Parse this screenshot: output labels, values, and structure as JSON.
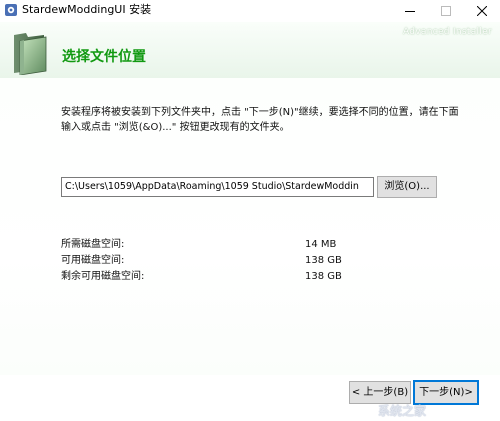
{
  "window": {
    "title": "StardewModdingUI 安装",
    "controls": [
      "minimize",
      "maximize",
      "close"
    ]
  },
  "header": {
    "title": "选择文件位置",
    "brand": "Advanced Installer",
    "icon": "green-folder-icon"
  },
  "description": "安装程序将被安装到下列文件夹中，点击 \"下一步(N)\"继续，要选择不同的位置，请在下面输入或点击 \"浏览(&O)...\" 按钮更改现有的文件夹。",
  "path": {
    "value": "C:\\Users\\1059\\AppData\\Roaming\\1059 Studio\\StardewModdin",
    "browse_label": "浏览(O)..."
  },
  "disk_space": [
    {
      "label": "所需磁盘空间:",
      "value": "14 MB"
    },
    {
      "label": "可用磁盘空间:",
      "value": "138 GB"
    },
    {
      "label": "剩余可用磁盘空间:",
      "value": "138 GB"
    }
  ],
  "footer": {
    "back_label": "< 上一步(B)",
    "next_label": "下一步(N)>"
  },
  "watermark": {
    "text": "系统之家"
  },
  "colors": {
    "header_title": "#119911",
    "focus_border": "#0078d7"
  }
}
